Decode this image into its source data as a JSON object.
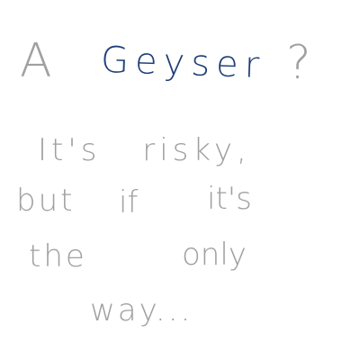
{
  "note": {
    "title_a": "A",
    "title_word": "Geyser",
    "title_mark": "?",
    "line1": "It's risky,",
    "line2_a": "but",
    "line2_b": "if",
    "line2_c": "it's",
    "line3_a": "the",
    "line3_b": "only",
    "line4": "way..."
  },
  "colors": {
    "pencil_gray": "#a0a0a0",
    "ink_blue": "#1f3f78",
    "paper": "#ffffff"
  }
}
